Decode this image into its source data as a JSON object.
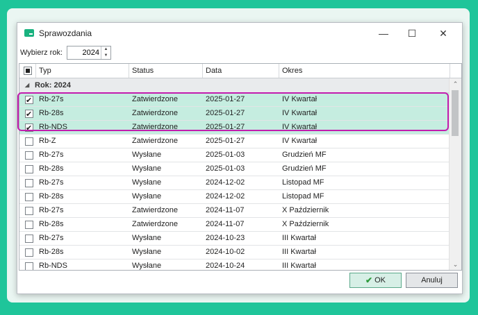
{
  "window": {
    "title": "Sprawozdania"
  },
  "controls": {
    "minimize": "—",
    "maximize": "☐",
    "close": "✕"
  },
  "toolbar": {
    "year_label": "Wybierz rok:",
    "year_value": "2024"
  },
  "grid": {
    "columns": [
      "Typ",
      "Status",
      "Data",
      "Okres"
    ],
    "group_label": "Rok: 2024",
    "rows": [
      {
        "checked": true,
        "typ": "Rb-27s",
        "status": "Zatwierdzone",
        "data": "2025-01-27",
        "okres": "IV Kwartał"
      },
      {
        "checked": true,
        "typ": "Rb-28s",
        "status": "Zatwierdzone",
        "data": "2025-01-27",
        "okres": "IV Kwartał"
      },
      {
        "checked": true,
        "typ": "Rb-NDS",
        "status": "Zatwierdzone",
        "data": "2025-01-27",
        "okres": "IV Kwartał"
      },
      {
        "checked": false,
        "typ": "Rb-Z",
        "status": "Zatwierdzone",
        "data": "2025-01-27",
        "okres": "IV Kwartał"
      },
      {
        "checked": false,
        "typ": "Rb-27s",
        "status": "Wysłane",
        "data": "2025-01-03",
        "okres": "Grudzień MF"
      },
      {
        "checked": false,
        "typ": "Rb-28s",
        "status": "Wysłane",
        "data": "2025-01-03",
        "okres": "Grudzień MF"
      },
      {
        "checked": false,
        "typ": "Rb-27s",
        "status": "Wysłane",
        "data": "2024-12-02",
        "okres": "Listopad MF"
      },
      {
        "checked": false,
        "typ": "Rb-28s",
        "status": "Wysłane",
        "data": "2024-12-02",
        "okres": "Listopad MF"
      },
      {
        "checked": false,
        "typ": "Rb-27s",
        "status": "Zatwierdzone",
        "data": "2024-11-07",
        "okres": "X Październik"
      },
      {
        "checked": false,
        "typ": "Rb-28s",
        "status": "Zatwierdzone",
        "data": "2024-11-07",
        "okres": "X Październik"
      },
      {
        "checked": false,
        "typ": "Rb-27s",
        "status": "Wysłane",
        "data": "2024-10-23",
        "okres": "III Kwartał"
      },
      {
        "checked": false,
        "typ": "Rb-28s",
        "status": "Wysłane",
        "data": "2024-10-02",
        "okres": "III Kwartał"
      },
      {
        "checked": false,
        "typ": "Rb-NDS",
        "status": "Wysłane",
        "data": "2024-10-24",
        "okres": "III Kwartał"
      }
    ]
  },
  "buttons": {
    "ok": "OK",
    "cancel": "Anuluj"
  },
  "colors": {
    "background": "#1fc59a",
    "selected_row": "#c5ede0",
    "highlight_border": "#c21cae"
  },
  "icons": {
    "app": "report-icon",
    "ok": "checkmark-icon"
  }
}
